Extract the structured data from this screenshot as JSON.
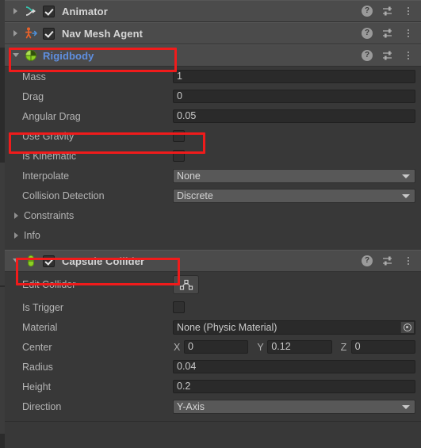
{
  "components": [
    {
      "id": "animator",
      "name": "Animator",
      "icon": "animator-icon",
      "expanded": false,
      "has_checkbox": true,
      "checked": true,
      "highlighted": false,
      "title_link": false
    },
    {
      "id": "nav-mesh-agent",
      "name": "Nav Mesh Agent",
      "icon": "nav-mesh-agent-icon",
      "expanded": false,
      "has_checkbox": true,
      "checked": true,
      "highlighted": false,
      "title_link": false
    },
    {
      "id": "rigidbody",
      "name": "Rigidbody",
      "icon": "rigidbody-icon",
      "expanded": true,
      "has_checkbox": false,
      "checked": false,
      "highlighted": true,
      "title_link": true
    },
    {
      "id": "capsule-collider",
      "name": "Capsule Collider",
      "icon": "capsule-collider-icon",
      "expanded": true,
      "has_checkbox": true,
      "checked": true,
      "highlighted": true,
      "title_link": false
    }
  ],
  "header_icons": {
    "help": "help-icon",
    "preset": "preset-icon",
    "menu": "more-menu-icon"
  },
  "rigidbody": {
    "mass": {
      "label": "Mass",
      "value": "1"
    },
    "drag": {
      "label": "Drag",
      "value": "0"
    },
    "angular_drag": {
      "label": "Angular Drag",
      "value": "0.05"
    },
    "use_gravity": {
      "label": "Use Gravity",
      "checked": false,
      "highlighted": true
    },
    "is_kinematic": {
      "label": "Is Kinematic",
      "checked": false
    },
    "interpolate": {
      "label": "Interpolate",
      "value": "None"
    },
    "collision_detection": {
      "label": "Collision Detection",
      "value": "Discrete"
    },
    "constraints": {
      "label": "Constraints"
    },
    "info": {
      "label": "Info"
    }
  },
  "capsule_collider": {
    "edit_collider": {
      "label": "Edit Collider",
      "button": "edit-collider-button"
    },
    "is_trigger": {
      "label": "Is Trigger",
      "checked": false
    },
    "material": {
      "label": "Material",
      "value": "None (Physic Material)"
    },
    "center": {
      "label": "Center",
      "axes": [
        {
          "axis": "X",
          "value": "0"
        },
        {
          "axis": "Y",
          "value": "0.12"
        },
        {
          "axis": "Z",
          "value": "0"
        }
      ]
    },
    "radius": {
      "label": "Radius",
      "value": "0.04"
    },
    "height": {
      "label": "Height",
      "value": "0.2"
    },
    "direction": {
      "label": "Direction",
      "value": "Y-Axis"
    }
  },
  "colors": {
    "background": "#383838",
    "header": "#4b4b4b",
    "field": "#2a2a2a",
    "dropdown": "#585858",
    "annotation": "#f01b1b",
    "link": "#5f8fe0",
    "rigidbody_icon": "#8cd124",
    "collider_icon": "#8cd124",
    "animator_icon": "#36c4ae",
    "navmesh_icon": "#e8622a"
  }
}
